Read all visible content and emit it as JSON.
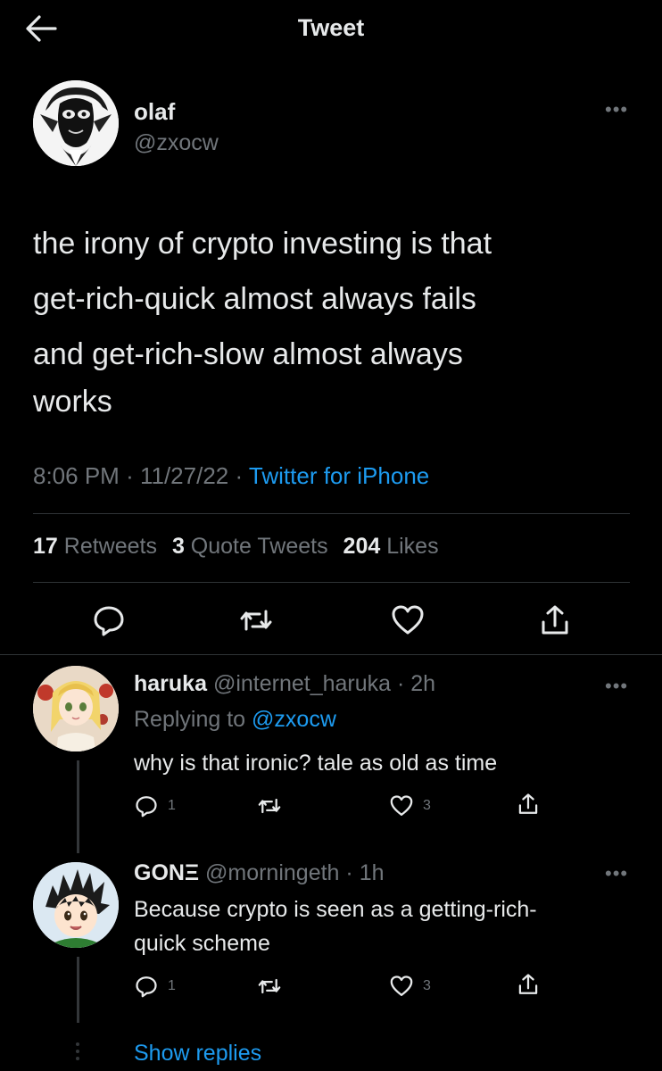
{
  "header": {
    "title": "Tweet"
  },
  "tweet": {
    "author_name": "olaf",
    "author_handle": "@zxocw",
    "text_lines": [
      "the irony of crypto investing is that",
      "get-rich-quick almost always fails",
      "and get-rich-slow almost always",
      "works"
    ],
    "time": "8:06 PM",
    "date": "11/27/22",
    "source": "Twitter for iPhone",
    "retweets_count": "17",
    "retweets_label": "Retweets",
    "quotes_count": "3",
    "quotes_label": "Quote Tweets",
    "likes_count": "204",
    "likes_label": "Likes"
  },
  "replies": [
    {
      "name": "haruka",
      "handle": "@internet_haruka",
      "age": "2h",
      "replying_prefix": "Replying to",
      "replying_to": "@zxocw",
      "text": "why is that ironic? tale as old as time",
      "reply_count": "1",
      "like_count": "3"
    },
    {
      "name": "GONΞ",
      "handle": "@morningeth",
      "age": "1h",
      "text_lines": [
        "Because crypto is seen as a getting-rich-",
        "quick scheme"
      ],
      "reply_count": "1",
      "like_count": "3"
    }
  ],
  "show_replies": "Show replies",
  "separator": "·",
  "icons": {
    "back": "back-arrow-icon",
    "more": "more-icon",
    "reply": "reply-icon",
    "retweet": "retweet-icon",
    "like": "like-icon",
    "share": "share-icon"
  },
  "colors": {
    "link": "#1d9bf0",
    "muted": "#71767b",
    "text": "#e7e9ea",
    "background": "#000000"
  }
}
